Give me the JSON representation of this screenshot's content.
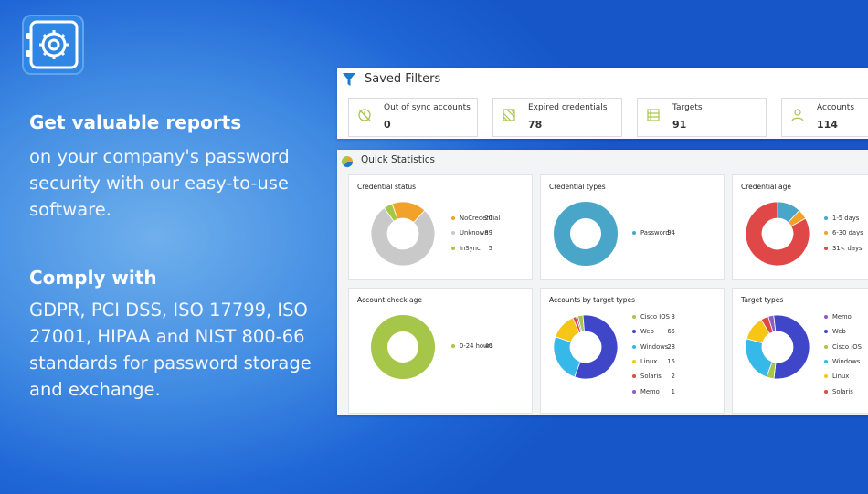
{
  "promo": {
    "heading1": "Get valuable reports",
    "para1": [
      "on your company's password",
      "security with our easy-to-use",
      "software."
    ],
    "heading2": "Comply with",
    "para2": [
      "GDPR, PCI DSS, ISO 17799, ISO",
      "27001, HIPAA and NIST 800-66",
      "standards for password storage",
      "and exchange."
    ]
  },
  "saved_filters": {
    "title": "Saved Filters",
    "cards": [
      {
        "label": "Out of sync accounts",
        "value": "0",
        "icon": "out-of-sync-icon"
      },
      {
        "label": "Expired credentials",
        "value": "78",
        "icon": "expired-credentials-icon"
      },
      {
        "label": "Targets",
        "value": "91",
        "icon": "targets-icon"
      },
      {
        "label": "Accounts",
        "value": "114",
        "icon": "accounts-icon"
      }
    ]
  },
  "quick_statistics": {
    "title": "Quick Statistics",
    "tiles": [
      {
        "title": "Credential status",
        "items": [
          {
            "name": "NoCredential",
            "value": "20",
            "color": "#f0a22b"
          },
          {
            "name": "Unknown",
            "value": "89",
            "color": "#c9c9c9"
          },
          {
            "name": "InSync",
            "value": "5",
            "color": "#a6c64a"
          }
        ]
      },
      {
        "title": "Credential types",
        "items": [
          {
            "name": "Password",
            "value": "94",
            "color": "#4aa6c9"
          }
        ]
      },
      {
        "title": "Credential age",
        "items": [
          {
            "name": "1-5 days",
            "value": "",
            "color": "#4aa6c9"
          },
          {
            "name": "6-30 days",
            "value": "",
            "color": "#f0a22b"
          },
          {
            "name": "31< days",
            "value": "",
            "color": "#e04848"
          }
        ]
      },
      {
        "title": "Account check age",
        "items": [
          {
            "name": "0-24 hours",
            "value": "40",
            "color": "#a6c64a"
          }
        ]
      },
      {
        "title": "Accounts by target types",
        "items": [
          {
            "name": "Cisco IOS",
            "value": "3",
            "color": "#a6c64a"
          },
          {
            "name": "Web",
            "value": "65",
            "color": "#3f46c8"
          },
          {
            "name": "Windows",
            "value": "28",
            "color": "#36b8e8"
          },
          {
            "name": "Linux",
            "value": "15",
            "color": "#f5c518"
          },
          {
            "name": "Solaris",
            "value": "2",
            "color": "#e04848"
          },
          {
            "name": "Memo",
            "value": "1",
            "color": "#8a5cc8"
          }
        ]
      },
      {
        "title": "Target types",
        "items": [
          {
            "name": "Memo",
            "value": "",
            "color": "#8a5cc8"
          },
          {
            "name": "Web",
            "value": "",
            "color": "#3f46c8"
          },
          {
            "name": "Cisco IOS",
            "value": "",
            "color": "#a6c64a"
          },
          {
            "name": "Windows",
            "value": "",
            "color": "#36b8e8"
          },
          {
            "name": "Linux",
            "value": "",
            "color": "#f5c518"
          },
          {
            "name": "Solaris",
            "value": "",
            "color": "#e04848"
          }
        ]
      }
    ]
  },
  "chart_data": [
    {
      "type": "pie",
      "title": "Credential status",
      "categories": [
        "NoCredential",
        "Unknown",
        "InSync"
      ],
      "values": [
        20,
        89,
        5
      ]
    },
    {
      "type": "pie",
      "title": "Credential types",
      "categories": [
        "Password"
      ],
      "values": [
        94
      ]
    },
    {
      "type": "pie",
      "title": "Credential age",
      "categories": [
        "1-5 days",
        "6-30 days",
        "31< days"
      ],
      "values": [
        12,
        5,
        83
      ]
    },
    {
      "type": "pie",
      "title": "Account check age",
      "categories": [
        "0-24 hours"
      ],
      "values": [
        40
      ]
    },
    {
      "type": "pie",
      "title": "Accounts by target types",
      "categories": [
        "Cisco IOS",
        "Web",
        "Windows",
        "Linux",
        "Solaris",
        "Memo"
      ],
      "values": [
        3,
        65,
        28,
        15,
        2,
        1
      ]
    },
    {
      "type": "pie",
      "title": "Target types",
      "categories": [
        "Memo",
        "Web",
        "Cisco IOS",
        "Windows",
        "Linux",
        "Solaris"
      ],
      "values": [
        3,
        57,
        4,
        25,
        13,
        4
      ]
    }
  ]
}
